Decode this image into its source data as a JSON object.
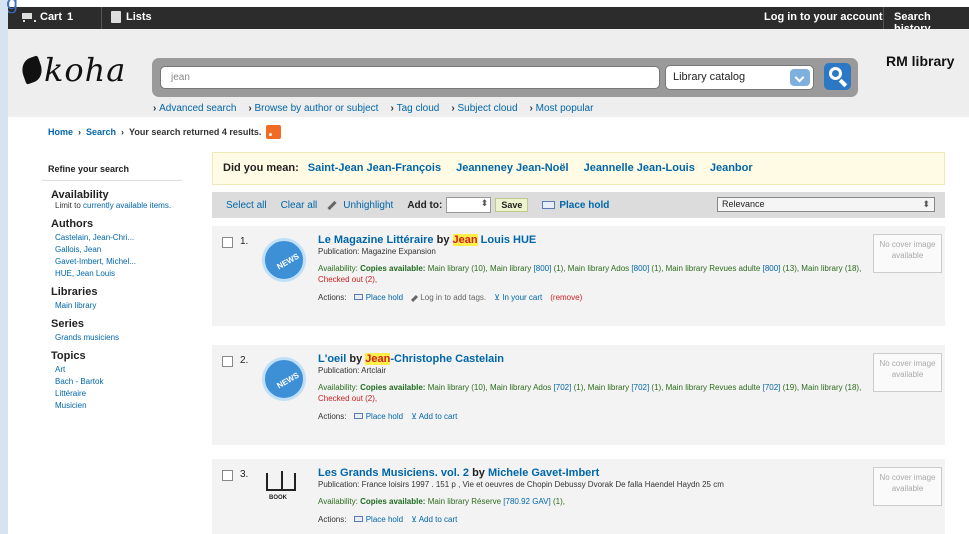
{
  "top_fragment": "g",
  "topbar": {
    "cart_label": "Cart",
    "cart_count": "1",
    "lists_label": "Lists",
    "login_label": "Log in to your account",
    "history_label": "Search history"
  },
  "header": {
    "logo_text": "koha",
    "search_value": "jean",
    "catalog_select": "Library catalog",
    "library_name": "RM library"
  },
  "more_links": [
    "Advanced search",
    "Browse by author or subject",
    "Tag cloud",
    "Subject cloud",
    "Most popular"
  ],
  "breadcrumb": {
    "home": "Home",
    "search": "Search",
    "summary": "Your search returned 4 results."
  },
  "refine": {
    "title": "Refine your search",
    "availability": {
      "heading": "Availability",
      "text": "Limit to",
      "link": "currently available items."
    },
    "authors": {
      "heading": "Authors",
      "items": [
        "Castelain, Jean-Chri...",
        "Gallois, Jean",
        "Gavet-Imbert, Michel...",
        "HUE, Jean Louis"
      ]
    },
    "libraries": {
      "heading": "Libraries",
      "items": [
        "Main library"
      ]
    },
    "series": {
      "heading": "Series",
      "items": [
        "Grands musiciens"
      ]
    },
    "topics": {
      "heading": "Topics",
      "items": [
        "Art",
        "Bach - Bartok",
        "Littéraire",
        "Musicien"
      ]
    }
  },
  "did_you_mean": {
    "label": "Did you mean:",
    "suggestions": [
      "Saint-Jean Jean-François",
      "Jeanneney Jean-Noël",
      "Jeannelle Jean-Louis",
      "Jeanbor"
    ]
  },
  "toolbar": {
    "select_all": "Select all",
    "clear_all": "Clear all",
    "unhighlight": "Unhighlight",
    "add_to": "Add to:",
    "save": "Save",
    "place_hold": "Place hold",
    "sort": "Relevance"
  },
  "colors": {
    "topbar": "#2c2c2c",
    "link": "#0066aa",
    "highlight": "#ffed4a",
    "available": "#1f6b1f",
    "checkedout": "#cc2222"
  },
  "results": [
    {
      "num": "1.",
      "thumb": "news-icon",
      "title": "Le Magazine Littéraire",
      "by": "by",
      "author_hl": "Jean",
      "author_rest": "Louis HUE",
      "publication": "Publication: Magazine Expansion",
      "avail_label": "Availability:",
      "copies": "Copies available:",
      "avail_text_a": "Main library (10), Main library",
      "call_a": "[800]",
      "avail_text_b": "(1), Main library Ados",
      "call_b": "[800]",
      "avail_text_c": "(1), Main library Revues adulte",
      "call_c": "[800]",
      "avail_text_d": "(13), Main library (18),",
      "checked_out": "Checked out (2),",
      "actions_label": "Actions:",
      "hold": "Place hold",
      "tags": "Log in to add tags.",
      "cart": "In your cart",
      "remove": "(remove)",
      "nocover": "No cover image available"
    },
    {
      "num": "2.",
      "thumb": "news-icon",
      "title": "L'oeil",
      "by": "by",
      "author_hl": "Jean",
      "author_rest": "-Christophe Castelain",
      "publication": "Publication: Artclair",
      "avail_label": "Availability:",
      "copies": "Copies available:",
      "avail_text_a": "Main library (10), Main library Ados",
      "call_a": "[702]",
      "avail_text_b": "(1), Main library",
      "call_b": "[702]",
      "avail_text_c": "(1), Main library Revues adulte",
      "call_c": "[702]",
      "avail_text_d": "(19), Main library (18),",
      "checked_out": "Checked out (2),",
      "actions_label": "Actions:",
      "hold": "Place hold",
      "cart": "Add to cart",
      "nocover": "No cover image available"
    },
    {
      "num": "3.",
      "thumb": "book-icon",
      "thumb_label": "BOOK",
      "title": "Les Grands Musiciens. vol. 2",
      "by": "by",
      "author_full": "Michele Gavet-Imbert",
      "publication": "Publication: France loisirs 1997 . 151 p , Vie et oeuvres de Chopin Debussy Dvorak De falla Haendel Haydn 25 cm",
      "avail_label": "Availability:",
      "copies": "Copies available:",
      "avail_text_a": "Main library Réserve",
      "call_a": "[780.92 GAV]",
      "avail_text_b": "(1),",
      "actions_label": "Actions:",
      "hold": "Place hold",
      "cart": "Add to cart",
      "nocover": "No cover image available"
    }
  ]
}
